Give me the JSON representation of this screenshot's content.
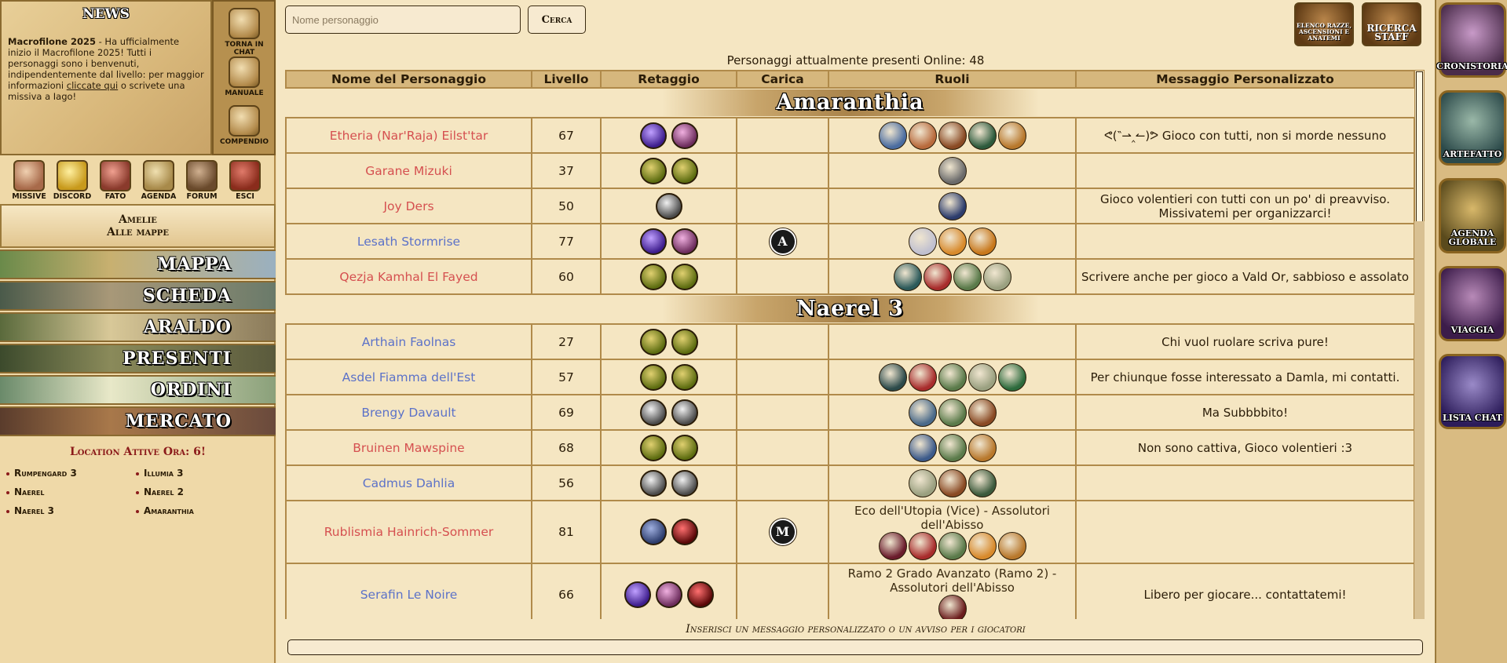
{
  "news": {
    "title": "NEWS",
    "headline": "Macrofilone 2025",
    "text_before_link": " - Ha ufficialmente inizio il Macrofilone 2025! Tutti i personaggi sono i benvenuti, indipendentemente dal livello: per maggior informazioni ",
    "link": "cliccate qui",
    "text_after_link": " o scrivete una missiva a Iago!"
  },
  "quick_buttons": [
    "TORNA IN CHAT",
    "MANUALE",
    "COMPENDIO"
  ],
  "icon_row": [
    "MISSIVE",
    "DISCORD",
    "FATO",
    "AGENDA",
    "FORUM",
    "ESCI"
  ],
  "character": {
    "name": "Amelie",
    "location": "Alle mappe"
  },
  "nav": [
    "MAPPA",
    "SCHEDA",
    "ARALDO",
    "PRESENTI",
    "ORDINI",
    "MERCATO"
  ],
  "locations": {
    "heading": "Location Attive Ora: 6!",
    "left": [
      "Rumpengard 3",
      "Naerel",
      "Naerel 3"
    ],
    "right": [
      "Illumia 3",
      "Naerel 2",
      "Amaranthia"
    ]
  },
  "search": {
    "placeholder": "Nome personaggio",
    "button": "Cerca"
  },
  "top_buttons": {
    "races": "ELENCO RAZZE, ASCENSIONI E ANATEMI",
    "staff": "RICERCA STAFF"
  },
  "online_text": "Personaggi attualmente presenti Online: 48",
  "columns": [
    "Nome del Personaggio",
    "Livello",
    "Retaggio",
    "Carica",
    "Ruoli",
    "Messaggio Personalizzato"
  ],
  "sections": [
    {
      "name": "Amaranthia",
      "rows": [
        {
          "name": "Etheria (Nar'Raja) Eilst'tar",
          "level": "67",
          "color": "red",
          "retaggi": [
            "purple",
            "pink"
          ],
          "carica": "",
          "ruoli": [
            "#4a6ca0",
            "#b86a3c",
            "#8a4a24",
            "#2c5a3c",
            "#b8782c"
          ],
          "msg": "ᕙ(‶⇀‸↼)ᕗ Gioco con tutti, non si morde nessuno"
        },
        {
          "name": "Garane Mizuki",
          "level": "37",
          "color": "red",
          "retaggi": [
            "green",
            "green"
          ],
          "carica": "",
          "ruoli": [
            "#6a6a6a"
          ],
          "msg": ""
        },
        {
          "name": "Joy Ders",
          "level": "50",
          "color": "red",
          "retaggi": [
            "gray"
          ],
          "carica": "",
          "ruoli": [
            "#2c3c6c"
          ],
          "msg": "Gioco volentieri con tutti con un po' di preavviso. Missivatemi per organizzarci!"
        },
        {
          "name": "Lesath Stormrise",
          "level": "77",
          "color": "blue",
          "retaggi": [
            "purple",
            "pink"
          ],
          "carica": "A",
          "ruoli": [
            "#c0c0d0",
            "#d88a2c",
            "#c8781c"
          ],
          "msg": ""
        },
        {
          "name": "Qezja Kamhal El Fayed",
          "level": "60",
          "color": "red",
          "retaggi": [
            "green",
            "green"
          ],
          "carica": "",
          "ruoli": [
            "#2c5a5a",
            "#a82c2c",
            "#5a7a4a",
            "#9aa080"
          ],
          "msg": "Scrivere anche per gioco a Vald Or, sabbioso e assolato"
        }
      ]
    },
    {
      "name": "Naerel 3",
      "rows": [
        {
          "name": "Arthain Faolnas",
          "level": "27",
          "color": "blue",
          "retaggi": [
            "green",
            "green"
          ],
          "carica": "",
          "ruoli": [],
          "msg": "Chi vuol ruolare scriva pure!"
        },
        {
          "name": "Asdel Fiamma dell'Est",
          "level": "57",
          "color": "blue",
          "retaggi": [
            "green",
            "green"
          ],
          "carica": "",
          "ruoli": [
            "#2c4a4a",
            "#a82c2c",
            "#5a7a4a",
            "#9aa080",
            "#2c6a3c"
          ],
          "msg": "Per chiunque fosse interessato a Damla, mi contatti."
        },
        {
          "name": "Brengy Davault",
          "level": "69",
          "color": "blue",
          "retaggi": [
            "gray",
            "gray"
          ],
          "carica": "",
          "ruoli": [
            "#4a6a8a",
            "#5a7a4a",
            "#8a4a24"
          ],
          "msg": "Ma Subbbbito!"
        },
        {
          "name": "Bruinen Mawspine",
          "level": "68",
          "color": "red",
          "retaggi": [
            "green",
            "green"
          ],
          "carica": "",
          "ruoli": [
            "#3c5a8a",
            "#5a7a4a",
            "#b8782c"
          ],
          "msg": "Non sono cattiva, Gioco volentieri :3"
        },
        {
          "name": "Cadmus Dahlia",
          "level": "56",
          "color": "blue",
          "retaggi": [
            "gray",
            "gray"
          ],
          "carica": "",
          "ruoli": [
            "#9aa080",
            "#8a4a24",
            "#3c5a3c"
          ],
          "msg": ""
        }
      ]
    }
  ],
  "extra_rows": [
    {
      "name": "Rublismia Hainrich-Sommer",
      "level": "81",
      "color": "red",
      "retaggi": [
        "blue",
        "red"
      ],
      "carica": "M",
      "alt": "Eco dell'Utopia (Vice) - Assolutori dell'Abisso",
      "ruoli": [
        "#6a1c2c",
        "#a82c2c",
        "#5a7a4a",
        "#d88a2c",
        "#b8782c"
      ],
      "msg": ""
    },
    {
      "name": "Serafin Le Noire",
      "level": "66",
      "color": "blue",
      "retaggi": [
        "purple",
        "pink",
        "red"
      ],
      "carica": "",
      "alt": "Ramo 2 Grado Avanzato (Ramo 2) - Assolutori dell'Abisso",
      "ruoli": [
        "#6a1c1c"
      ],
      "msg": "Libero per giocare... contattatemi!"
    }
  ],
  "message_label": "Inserisci un messaggio personalizzato o un avviso per i giocatori",
  "right_nav": [
    "CRONISTORIA",
    "ARTEFATTO",
    "AGENDA GLOBALE",
    "VIAGGIA",
    "LISTA CHAT"
  ]
}
